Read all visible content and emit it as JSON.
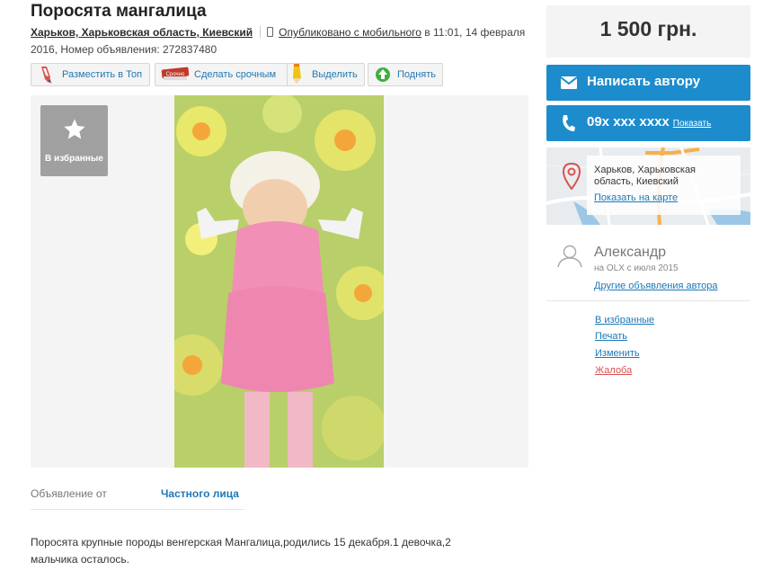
{
  "ad": {
    "title": "Поросята мангалица",
    "location": "Харьков, Харьковская область, Киевский",
    "published_mobile": "Опубликовано с мобильного",
    "published_time": " в 11:01, 14 февраля",
    "date_year_id": "2016, Номер объявления: 272837480",
    "from_label": "Объявление от",
    "from_value": "Частного лица",
    "description_line1": "Поросята крупные породы венгерская Мангалица,родились 15 декабря.1 девочка,2",
    "description_line2": "мальчика осталось."
  },
  "actions": {
    "top": "Разместить в Топ",
    "urgent": "Сделать срочным",
    "urgent_badge": "Срочно",
    "highlight": "Выделить",
    "lift": "Поднять"
  },
  "gallery": {
    "favorite_label": "В избранные"
  },
  "sidebar": {
    "price": "1 500 грн.",
    "write_author": "Написать автору",
    "phone": "09x xxx xxxx",
    "show_phone": "Показать",
    "map_address": "Харьков, Харьковская область, Киевский",
    "map_link": "Показать на карте",
    "user_name": "Александр",
    "user_since": "на OLX с июля 2015",
    "other_ads": "Другие объявления автора",
    "links": [
      "В избранные",
      "Печать",
      "Изменить",
      "Жалоба"
    ]
  },
  "colors": {
    "accent": "#1d8ccd",
    "link": "#1d78b8",
    "report": "#d9534f",
    "panel": "#f4f4f4"
  },
  "icons": [
    "rocket-icon",
    "urgent-badge-icon",
    "pencil-icon",
    "up-arrow-icon",
    "star-icon",
    "envelope-icon",
    "phone-icon",
    "map-pin-icon",
    "user-icon"
  ]
}
